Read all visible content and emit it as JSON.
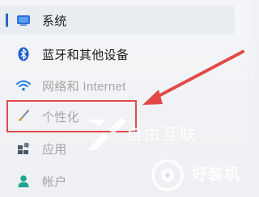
{
  "sidebar": {
    "items": [
      {
        "label": "系统",
        "icon": "monitor-icon"
      },
      {
        "label": "蓝牙和其他设备",
        "icon": "bluetooth-icon"
      },
      {
        "label": "网络和 Internet",
        "icon": "wifi-icon"
      },
      {
        "label": "个性化",
        "icon": "brush-icon"
      },
      {
        "label": "应用",
        "icon": "apps-icon"
      },
      {
        "label": "帐户",
        "icon": "person-icon"
      }
    ],
    "selected_index": 0
  },
  "annotation": {
    "box_color": "#e24a4a",
    "arrow_color": "#e24a4a"
  },
  "watermarks": [
    "自由互联",
    "好装机"
  ],
  "colors": {
    "accent": "#2c61c9",
    "bluetooth": "#1f5fcf",
    "wifi": "#1e7be0"
  }
}
